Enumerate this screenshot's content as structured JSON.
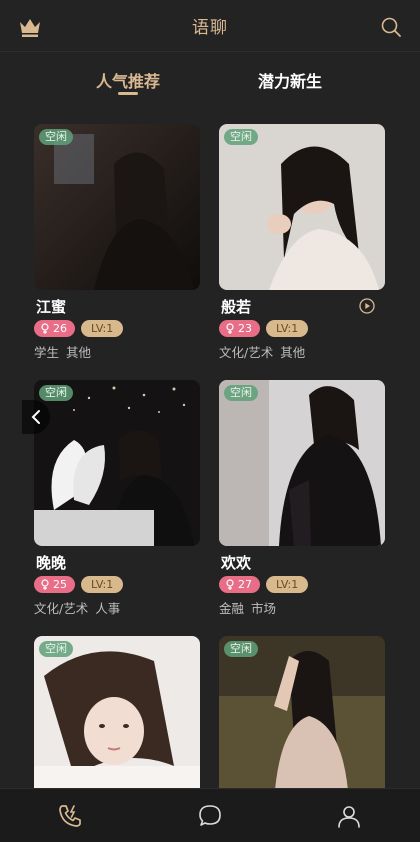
{
  "header": {
    "title": "语聊",
    "crown_icon": "crown-icon",
    "search_icon": "search-icon",
    "accent_color": "#d9b991"
  },
  "tabs": [
    {
      "label": "人气推荐",
      "active": true
    },
    {
      "label": "潜力新生",
      "active": false
    }
  ],
  "cards": [
    {
      "status": "空闲",
      "name": "江蜜",
      "age": "26",
      "level": "LV:1",
      "tags": [
        "学生",
        "其他"
      ]
    },
    {
      "status": "空闲",
      "name": "般若",
      "age": "23",
      "level": "LV:1",
      "tags": [
        "文化/艺术",
        "其他"
      ],
      "has_voice": true
    },
    {
      "status": "空闲",
      "name": "晚晚",
      "age": "25",
      "level": "LV:1",
      "tags": [
        "文化/艺术",
        "人事"
      ]
    },
    {
      "status": "空闲",
      "name": "欢欢",
      "age": "27",
      "level": "LV:1",
      "tags": [
        "金融",
        "市场"
      ]
    },
    {
      "status": "空闲"
    },
    {
      "status": "空闲"
    }
  ],
  "bottom_nav": [
    {
      "icon": "phone-call-icon",
      "active": true
    },
    {
      "icon": "chat-bubble-icon",
      "active": false
    },
    {
      "icon": "user-profile-icon",
      "active": false
    }
  ]
}
